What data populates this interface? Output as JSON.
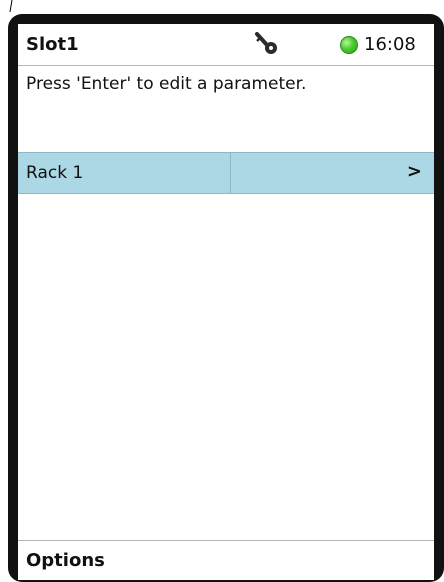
{
  "header": {
    "title": "Slot1",
    "time": "16:08",
    "status_color": "#4ccc2e",
    "status_icon": "green-status-led-icon",
    "lock_icon": "key-icon"
  },
  "message": {
    "text": "Press 'Enter' to edit a parameter."
  },
  "list": {
    "selected_color": "#acd8e6",
    "items": [
      {
        "label": "Rack 1",
        "indicator": ">"
      }
    ]
  },
  "softkeys": {
    "left_label": "Options"
  }
}
